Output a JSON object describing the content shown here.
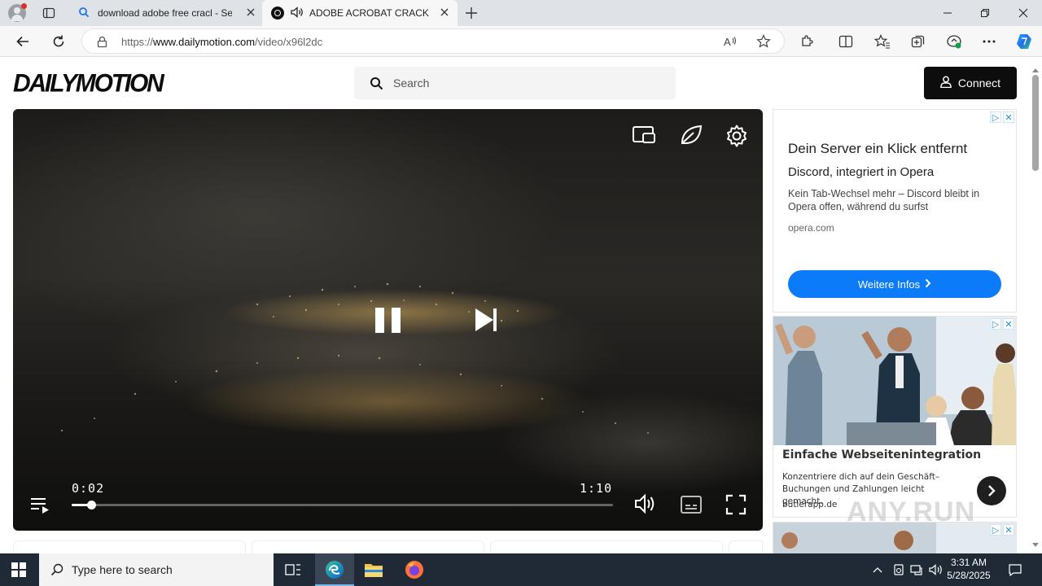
{
  "browser": {
    "tabs": [
      {
        "title": "download adobe free cracl - Sear",
        "icon": "search-icon"
      },
      {
        "title": "ADOBE ACROBAT CRACK | A",
        "icon": "dailymotion-icon",
        "audio": true
      }
    ],
    "url_prefix": "https://",
    "url_host": "www.dailymotion.com",
    "url_path": "/video/x96l2dc"
  },
  "site": {
    "logo": "DAILYMOTION",
    "search_placeholder": "Search",
    "connect_label": "Connect"
  },
  "player": {
    "current_time": "0:02",
    "duration": "1:10",
    "progress_fraction": 0.036
  },
  "ad1": {
    "title": "Dein Server ein Klick entfernt",
    "subtitle": "Discord, integriert in Opera",
    "description": "Kein Tab-Wechsel mehr – Discord bleibt in Opera offen, während du surfst",
    "domain": "opera.com",
    "cta": "Weitere Infos"
  },
  "ad2": {
    "title": "Einfache Webseitenintegration",
    "description": "Konzentriere dich auf dein Geschäft– Buchungen und Zahlungen leicht gemacht.",
    "domain": "butlerapp.de"
  },
  "watermark": "ANY.RUN",
  "taskbar": {
    "search_placeholder": "Type here to search",
    "time": "3:31 AM",
    "date": "5/28/2025"
  },
  "colors": {
    "accent_blue": "#0b7bfa",
    "edge_accent": "#0078d4"
  }
}
